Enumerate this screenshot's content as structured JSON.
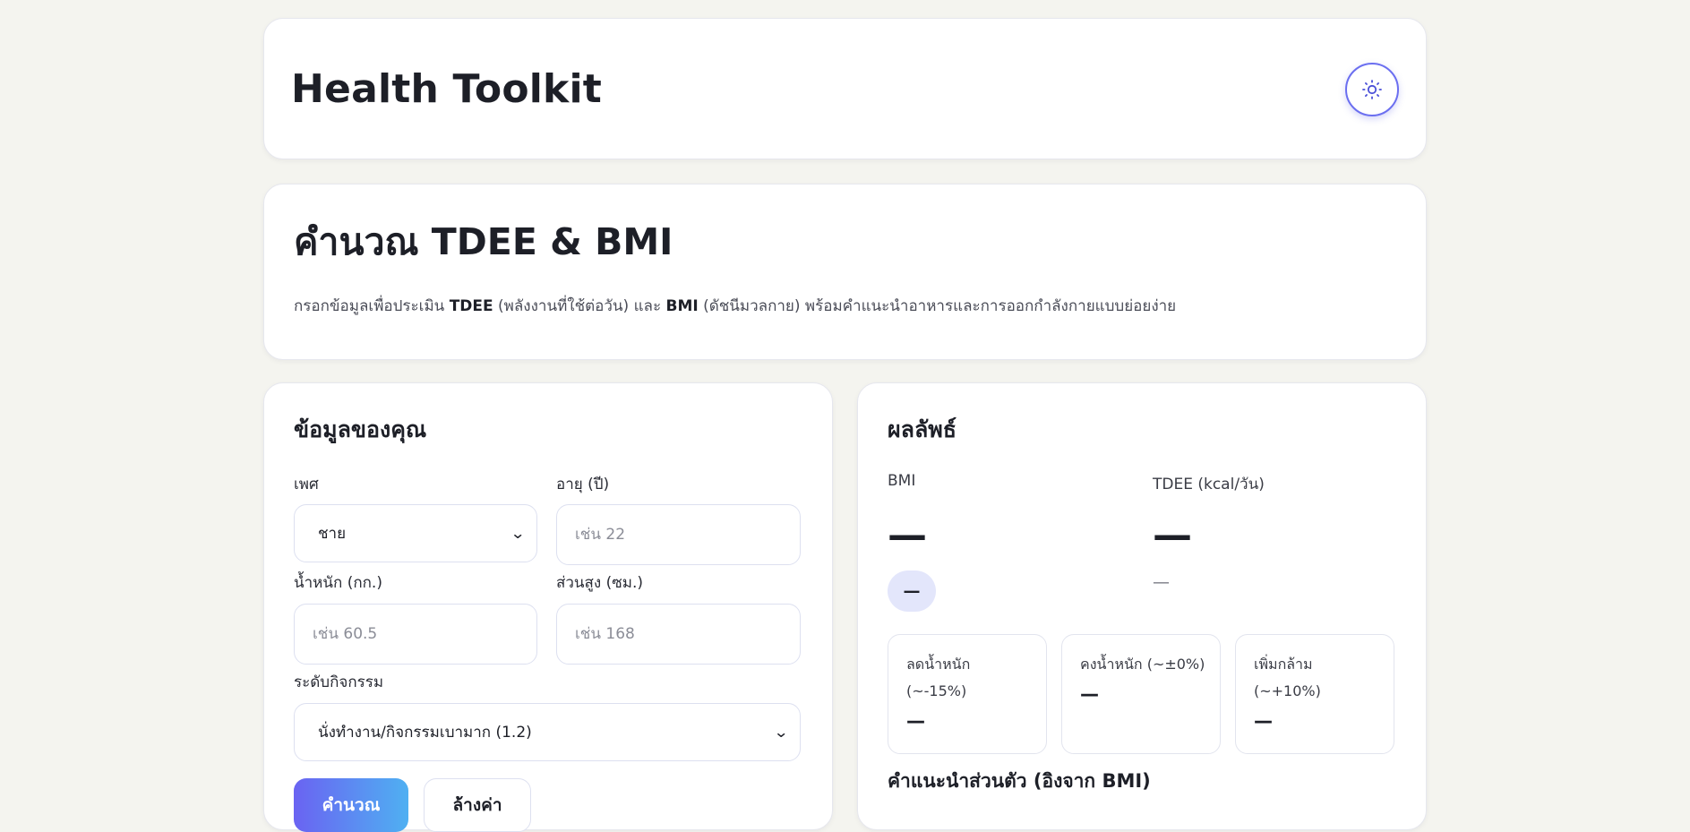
{
  "app": {
    "title": "Health Toolkit",
    "theme_toggle_icon": "sun-icon"
  },
  "intro": {
    "title": "คำนวณ TDEE & BMI",
    "desc_prefix": "กรอกข้อมูลเพื่อประเมิน ",
    "desc_tdee": "TDEE",
    "desc_tdee_expl": " (พลังงานที่ใช้ต่อวัน) และ ",
    "desc_bmi": "BMI",
    "desc_suffix": " (ดัชนีมวลกาย) พร้อมคำแนะนำอาหารและการออกกำลังกายแบบย่อยง่าย"
  },
  "form": {
    "title": "ข้อมูลของคุณ",
    "sex_label": "เพศ",
    "sex_value": "ชาย",
    "age_label": "อายุ (ปี)",
    "age_placeholder": "เช่น 22",
    "weight_label": "น้ำหนัก (กก.)",
    "weight_placeholder": "เช่น 60.5",
    "height_label": "ส่วนสูง (ซม.)",
    "height_placeholder": "เช่น 168",
    "activity_label": "ระดับกิจกรรม",
    "activity_value": "นั่งทำงาน/กิจกรรมเบามาก (1.2)",
    "calculate_label": "คำนวณ",
    "reset_label": "ล้างค่า"
  },
  "results": {
    "title": "ผลลัพธ์",
    "bmi_label": "BMI",
    "bmi_value": "—",
    "bmi_category": "—",
    "tdee_label": "TDEE (kcal/วัน)",
    "tdee_value": "—",
    "tdee_note": "—",
    "goals": [
      {
        "label": "ลดน้ำหนัก (~-15%)",
        "value": "—"
      },
      {
        "label": "คงน้ำหนัก (~±0%)",
        "value": "—"
      },
      {
        "label": "เพิ่มกล้าม (~+10%)",
        "value": "—"
      }
    ],
    "advice_title": "คำแนะนำส่วนตัว (อิงจาก BMI)"
  },
  "colors": {
    "background": "#f4f4ef",
    "accent": "#6b6ff0",
    "gradient_start": "#6a63f2",
    "gradient_end": "#4fb0f2",
    "badge_bg": "#e3e6fb"
  }
}
